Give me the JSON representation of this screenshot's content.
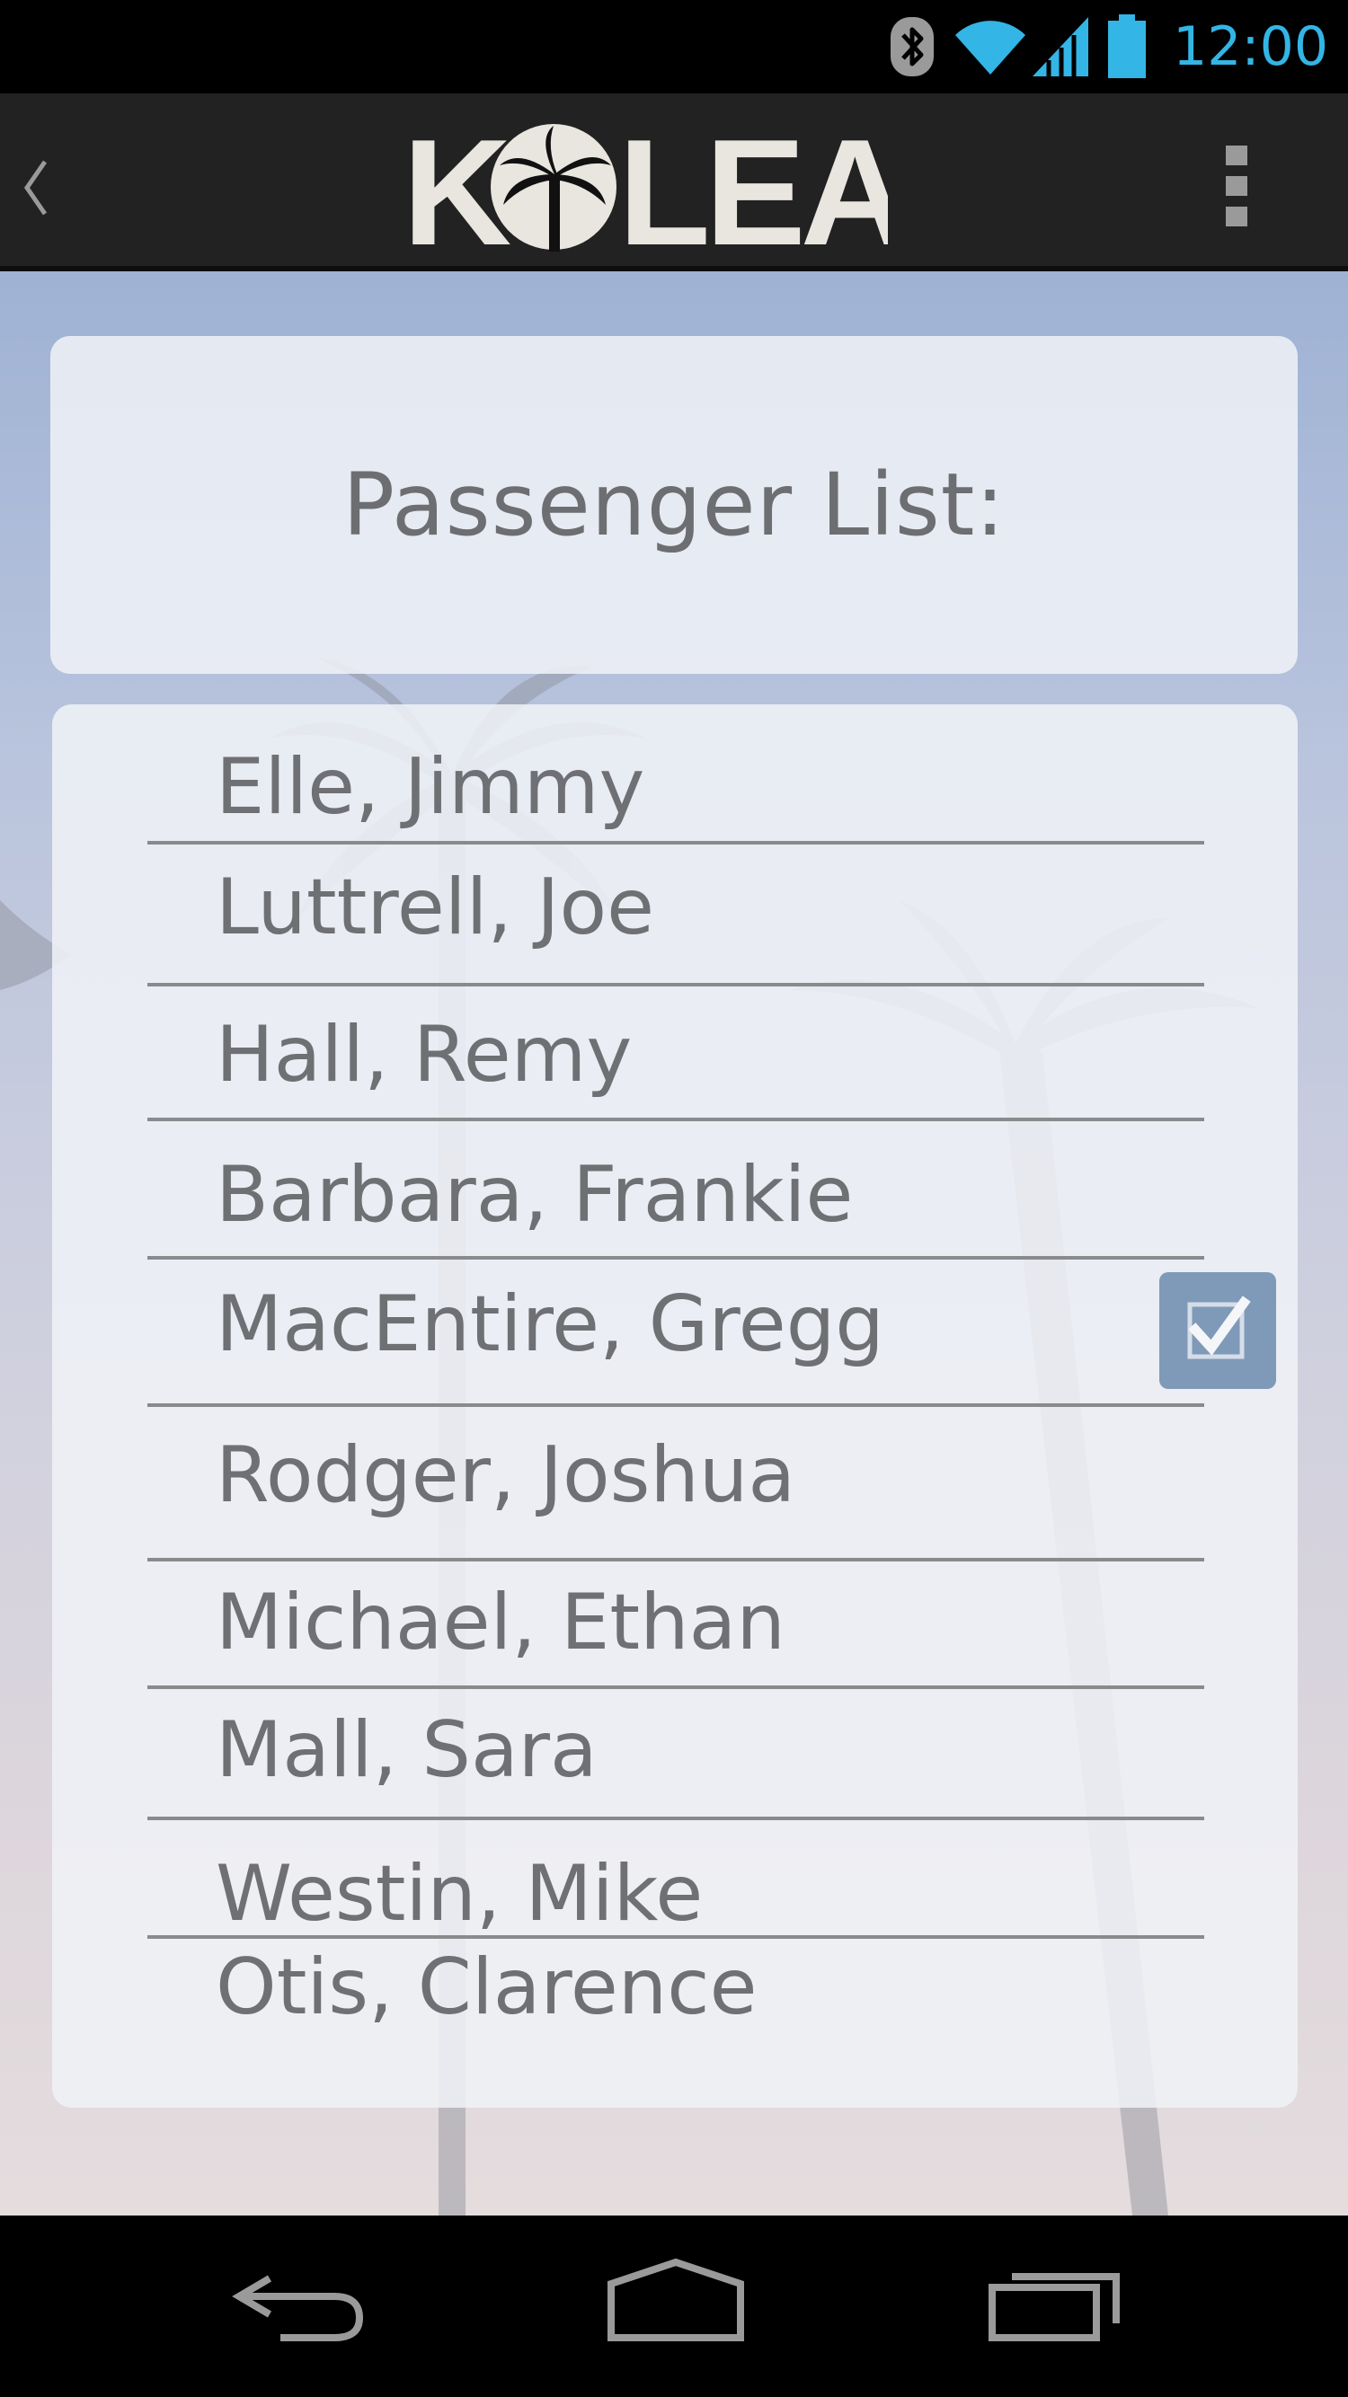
{
  "status_bar": {
    "time": "12:00",
    "icons": [
      "bluetooth-icon",
      "wifi-icon",
      "cellular-signal-icon",
      "battery-icon"
    ],
    "accent_color": "#33b5e5"
  },
  "action_bar": {
    "logo_text": "KOLEA",
    "back_icon": "chevron-left-icon",
    "overflow_icon": "overflow-menu-icon"
  },
  "header": {
    "title": "Passenger List:"
  },
  "passengers": [
    {
      "name": "Elle, Jimmy",
      "checked": false
    },
    {
      "name": "Luttrell, Joe",
      "checked": false
    },
    {
      "name": "Hall, Remy",
      "checked": false
    },
    {
      "name": "Barbara, Frankie",
      "checked": false
    },
    {
      "name": "MacEntire, Gregg",
      "checked": true
    },
    {
      "name": "Rodger, Joshua",
      "checked": false
    },
    {
      "name": "Michael, Ethan",
      "checked": false
    },
    {
      "name": "Mall, Sara",
      "checked": false
    },
    {
      "name": "Westin, Mike",
      "checked": false
    },
    {
      "name": "Otis, Clarence",
      "checked": false
    }
  ],
  "nav_bar": {
    "buttons": [
      "back-nav-icon",
      "home-nav-icon",
      "recent-apps-icon"
    ]
  }
}
